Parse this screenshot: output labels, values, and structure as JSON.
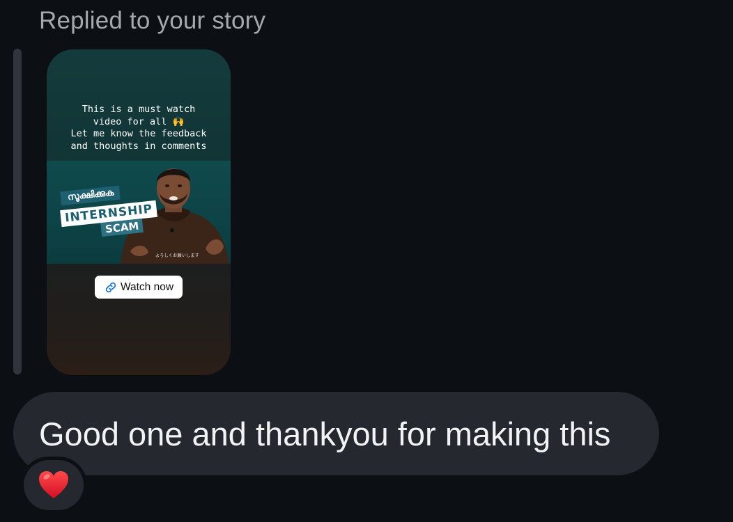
{
  "reply_context": {
    "label": "Replied to your story"
  },
  "story": {
    "caption": "This is a must watch\nvideo for all 🙌\nLet me know the feedback\nand thoughts in comments",
    "thumbnail": {
      "tag_malayalam": "സൂക്ഷിക്കുക",
      "tag_internship": "INTERNSHIP",
      "tag_scam": "SCAM",
      "subtitle": "よろしくお願いします"
    },
    "watch_button": {
      "label": "Watch now",
      "icon": "link-icon"
    }
  },
  "message": {
    "text": "Good one and thankyou for making this"
  },
  "reaction": {
    "emoji": "❤️",
    "icon": "heart-icon",
    "color": "#e0142b"
  },
  "colors": {
    "background": "#0c0f14",
    "bubble": "#25282e",
    "link_blue": "#1f7ae0"
  }
}
